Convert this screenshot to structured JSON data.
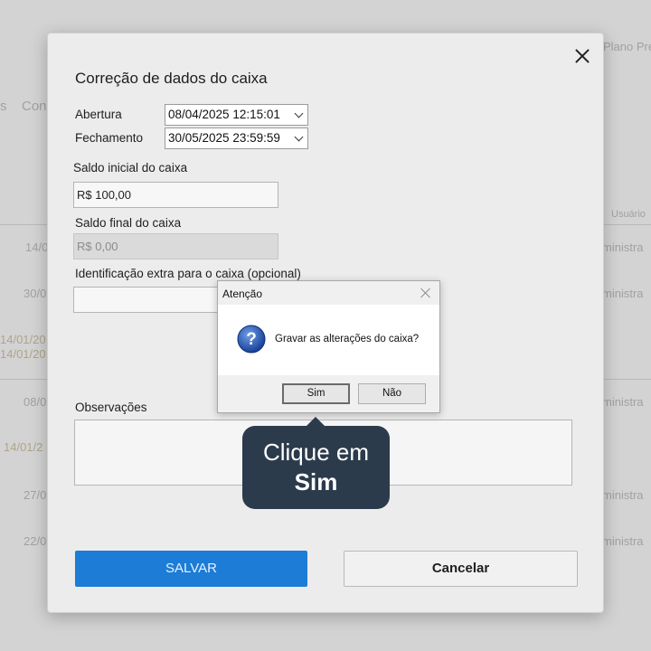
{
  "background": {
    "texts": [
      "Plano Pre",
      "s",
      "Con",
      "Usuário",
      "14/0",
      "30/0",
      "14/01/20",
      "14/01/20",
      "08/0",
      "14/01/2",
      "27/0",
      "22/0",
      "ministra",
      "ministra",
      "ministra",
      "ministra",
      "ministra"
    ]
  },
  "modal": {
    "title": "Correção de dados do caixa",
    "abertura_label": "Abertura",
    "abertura_value": "08/04/2025 12:15:01",
    "fechamento_label": "Fechamento",
    "fechamento_value": "30/05/2025 23:59:59",
    "saldo_inicial_label": "Saldo inicial do caixa",
    "saldo_inicial_value": "R$ 100,00",
    "saldo_final_label": "Saldo final do caixa",
    "saldo_final_value": "R$ 0,00",
    "identificacao_label": "Identificação extra para o caixa (opcional)",
    "identificacao_value": "",
    "observacoes_label": "Observações",
    "observacoes_value": "",
    "save_label": "SALVAR",
    "cancel_label": "Cancelar",
    "close_icon": "close-icon"
  },
  "dialog": {
    "title": "Atenção",
    "message": "Gravar as alterações do caixa?",
    "yes_label": "Sim",
    "no_label": "Não",
    "icon": "question-icon"
  },
  "tooltip": {
    "line1": "Clique em",
    "line2": "Sim"
  },
  "colors": {
    "primary": "#1c7cd6",
    "tooltip_bg": "#2c3b4c"
  }
}
